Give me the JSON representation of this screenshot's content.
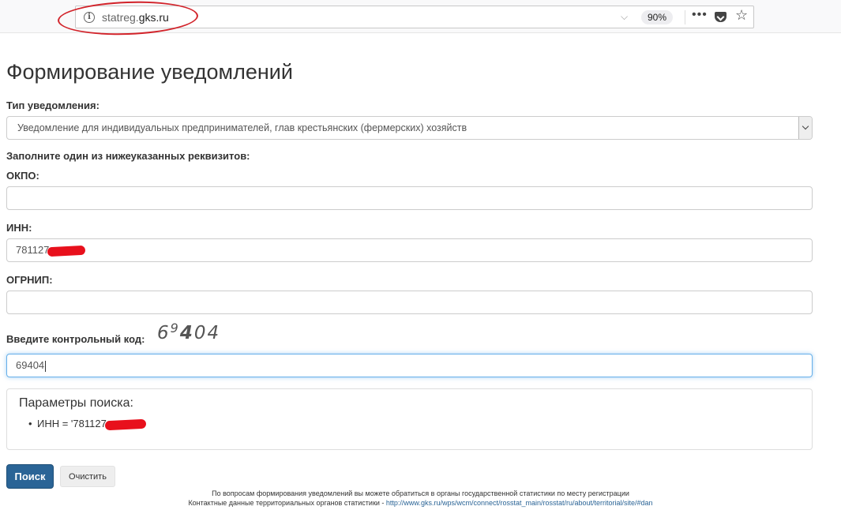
{
  "browser": {
    "url_prefix": "statreg.",
    "url_domain": "gks.ru",
    "zoom": "90%",
    "more_glyph": "•••",
    "star_glyph": "☆",
    "dropdown_glyph": "⌵",
    "info_glyph": "i"
  },
  "page": {
    "title": "Формирование уведомлений"
  },
  "form": {
    "type_label": "Тип уведомления:",
    "type_selected": "Уведомление для индивидуальных предпринимателей, глав крестьянских (фермерских) хозяйств",
    "requisites_hint": "Заполните один из нижеуказанных реквизитов:",
    "okpo_label": "ОКПО:",
    "okpo_value": "",
    "inn_label": "ИНН:",
    "inn_value": "781127",
    "ogrnip_label": "ОГРНИП:",
    "ogrnip_value": "",
    "captcha_label": "Введите контрольный код:",
    "captcha_parts": [
      "6",
      "9",
      "4",
      "04"
    ],
    "captcha_value": "69404"
  },
  "params": {
    "title": "Параметры поиска:",
    "item": "ИНН = '781127"
  },
  "buttons": {
    "search": "Поиск",
    "clear": "Очистить"
  },
  "footer": {
    "line1": "По вопросам формирования уведомлений вы можете обратиться в органы государственной статистики по месту регистрации",
    "line2_prefix": "Контактные данные территориальных органов статистики - ",
    "line2_link": "http://www.gks.ru/wps/wcm/connect/rosstat_main/rosstat/ru/about/territorial/site/#dan"
  },
  "colors": {
    "annotation_red": "#d2232a",
    "primary_button": "#2a6496",
    "focus_border": "#66afe9"
  }
}
